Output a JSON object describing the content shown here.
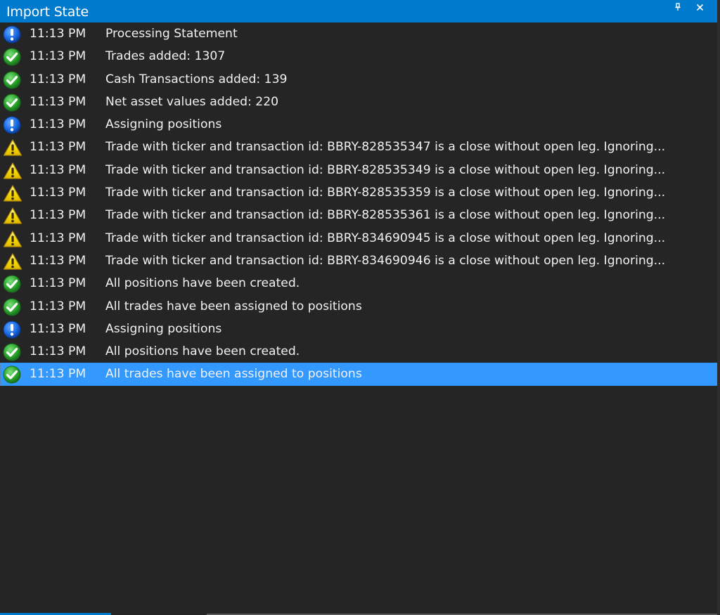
{
  "window": {
    "title": "Import State",
    "pin_icon": "pin-icon",
    "close_icon": "close-icon"
  },
  "colors": {
    "titlebar": "#007acc",
    "background": "#252525",
    "selected_row": "#3399ff",
    "text": "#f1f1f1",
    "info": "#1e6ee8",
    "success": "#2ea92e",
    "warning": "#f5d800"
  },
  "log": [
    {
      "type": "info",
      "icon": "info-icon",
      "time": "11:13 PM",
      "message": "Processing Statement"
    },
    {
      "type": "success",
      "icon": "checkmark-icon",
      "time": "11:13 PM",
      "message": "Trades added: 1307"
    },
    {
      "type": "success",
      "icon": "checkmark-icon",
      "time": "11:13 PM",
      "message": "Cash Transactions added: 139"
    },
    {
      "type": "success",
      "icon": "checkmark-icon",
      "time": "11:13 PM",
      "message": "Net asset values added: 220"
    },
    {
      "type": "info",
      "icon": "info-icon",
      "time": "11:13 PM",
      "message": "Assigning positions"
    },
    {
      "type": "warning",
      "icon": "warning-icon",
      "time": "11:13 PM",
      "message": "Trade with ticker and transaction id: BBRY-828535347 is a close without open leg. Ignoring..."
    },
    {
      "type": "warning",
      "icon": "warning-icon",
      "time": "11:13 PM",
      "message": "Trade with ticker and transaction id: BBRY-828535349 is a close without open leg. Ignoring..."
    },
    {
      "type": "warning",
      "icon": "warning-icon",
      "time": "11:13 PM",
      "message": "Trade with ticker and transaction id: BBRY-828535359 is a close without open leg. Ignoring..."
    },
    {
      "type": "warning",
      "icon": "warning-icon",
      "time": "11:13 PM",
      "message": "Trade with ticker and transaction id: BBRY-828535361 is a close without open leg. Ignoring..."
    },
    {
      "type": "warning",
      "icon": "warning-icon",
      "time": "11:13 PM",
      "message": "Trade with ticker and transaction id: BBRY-834690945 is a close without open leg. Ignoring..."
    },
    {
      "type": "warning",
      "icon": "warning-icon",
      "time": "11:13 PM",
      "message": "Trade with ticker and transaction id: BBRY-834690946 is a close without open leg. Ignoring..."
    },
    {
      "type": "success",
      "icon": "checkmark-icon",
      "time": "11:13 PM",
      "message": "All positions have been created."
    },
    {
      "type": "success",
      "icon": "checkmark-icon",
      "time": "11:13 PM",
      "message": "All trades have been assigned to positions"
    },
    {
      "type": "info",
      "icon": "info-icon",
      "time": "11:13 PM",
      "message": "Assigning positions"
    },
    {
      "type": "success",
      "icon": "checkmark-icon",
      "time": "11:13 PM",
      "message": "All positions have been created."
    },
    {
      "type": "success",
      "icon": "checkmark-icon",
      "time": "11:13 PM",
      "message": "All trades have been assigned to positions",
      "selected": true
    }
  ]
}
